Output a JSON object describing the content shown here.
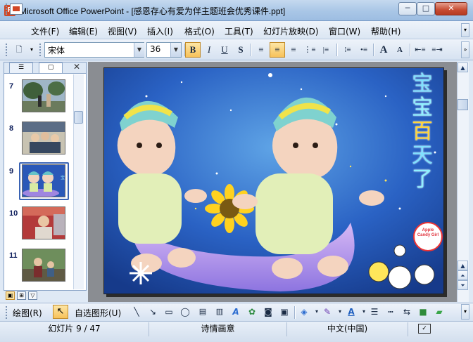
{
  "window": {
    "title": "Microsoft Office PowerPoint - [感恩存心有爱为伴主题班会优秀课件.ppt]",
    "app_icon": "powerpoint-icon",
    "buttons": {
      "minimize": "─",
      "maximize": "□",
      "close": "✕"
    }
  },
  "menu": {
    "items": [
      {
        "label": "文件(F)"
      },
      {
        "label": "编辑(E)"
      },
      {
        "label": "视图(V)"
      },
      {
        "label": "插入(I)"
      },
      {
        "label": "格式(O)"
      },
      {
        "label": "工具(T)"
      },
      {
        "label": "幻灯片放映(D)"
      },
      {
        "label": "窗口(W)"
      },
      {
        "label": "帮助(H)"
      }
    ]
  },
  "format_toolbar": {
    "font_name": "宋体",
    "font_size": "36",
    "bold": "B",
    "italic": "I",
    "underline": "U",
    "shadow": "S",
    "grow_font": "A",
    "shrink_font": "A"
  },
  "slides_pane": {
    "slides": [
      {
        "number": "7",
        "selected": false
      },
      {
        "number": "8",
        "selected": false
      },
      {
        "number": "9",
        "selected": true
      },
      {
        "number": "10",
        "selected": false
      },
      {
        "number": "11",
        "selected": false
      }
    ]
  },
  "slide": {
    "title_chars": [
      "宝",
      "宝",
      "百",
      "天",
      "了"
    ],
    "logo_text": "Apple Candy Girl",
    "colors": {
      "title": "#7fe0ff",
      "accent": "#ffd43a",
      "background": "#1c3f8f"
    }
  },
  "draw_toolbar": {
    "draw_label": "绘图(R)",
    "autoshapes_label": "自选图形(U)"
  },
  "status_bar": {
    "slide_info": "幻灯片 9 / 47",
    "design": "诗情画意",
    "language": "中文(中国)"
  }
}
